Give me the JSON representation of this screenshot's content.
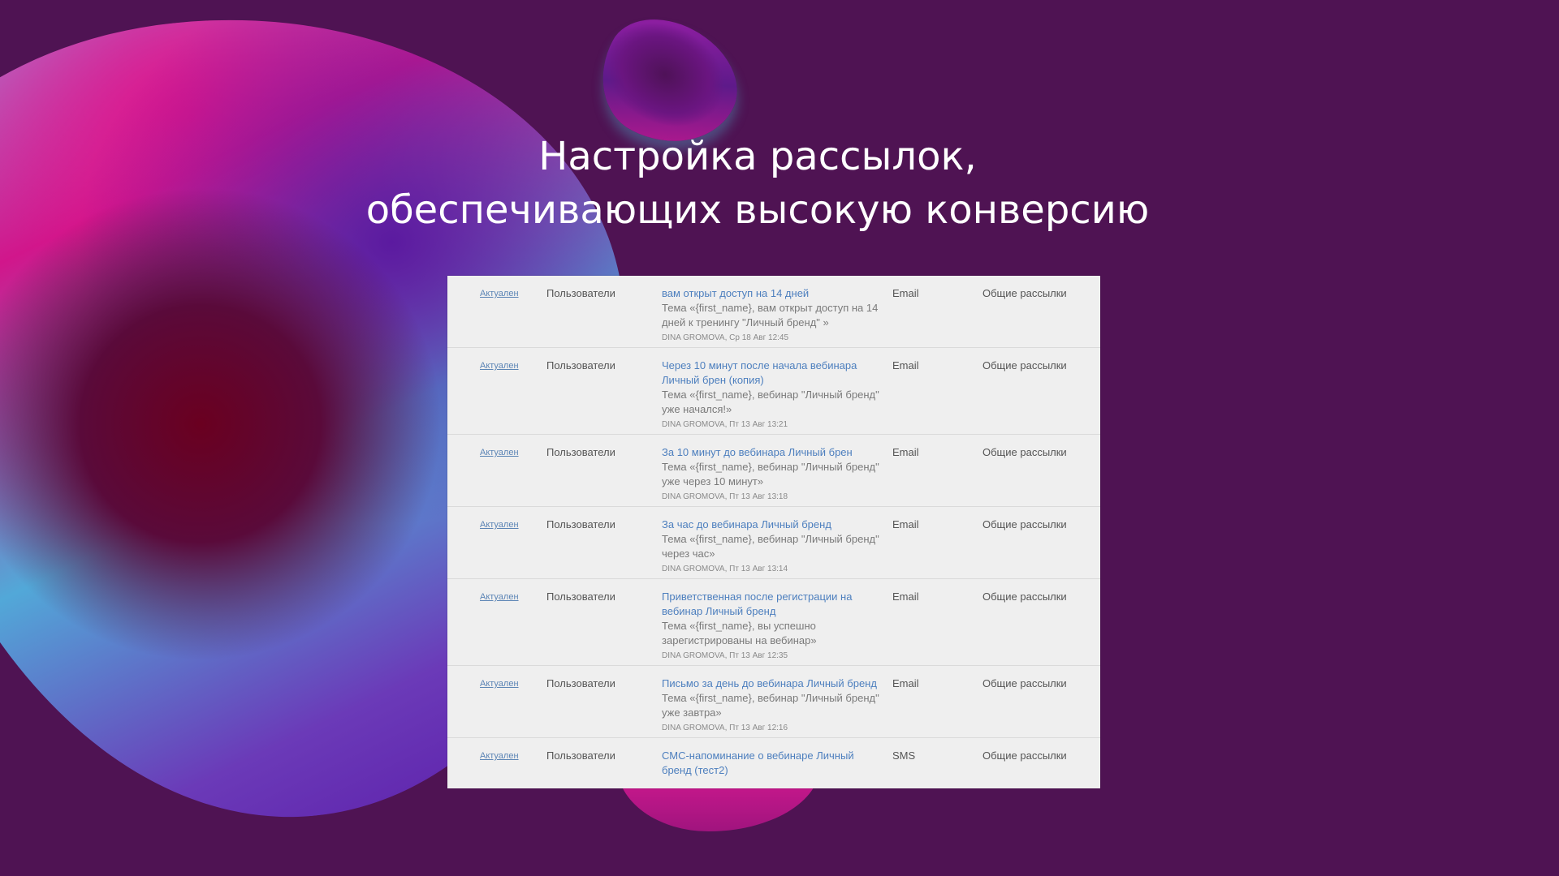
{
  "title_lines": [
    "Настройка рассылок,",
    "обеспечивающих высокую конверсию"
  ],
  "colors": {
    "background": "#4f1353",
    "table_bg": "#efefef",
    "link": "#4d7fbe",
    "text": "#555555"
  },
  "rows": [
    {
      "status": "Актуален",
      "audience": "Пользователи",
      "title": "вам открыт доступ на 14 дней",
      "subject": "Тема «{first_name}, вам открыт доступ на 14 дней к тренингу \"Личный бренд\" »",
      "meta": "DINA GROMOVA, Ср 18 Авг 12:45",
      "channel": "Email",
      "group": "Общие рассылки"
    },
    {
      "status": "Актуален",
      "audience": "Пользователи",
      "title": "Через 10 минут после начала вебинара Личный брен (копия)",
      "subject": "Тема «{first_name}, вебинар \"Личный бренд\" уже начался!»",
      "meta": "DINA GROMOVA, Пт 13 Авг 13:21",
      "channel": "Email",
      "group": "Общие рассылки"
    },
    {
      "status": "Актуален",
      "audience": "Пользователи",
      "title": "За 10 минут до вебинара Личный брен",
      "subject": "Тема «{first_name}, вебинар \"Личный бренд\" уже через 10 минут»",
      "meta": "DINA GROMOVA, Пт 13 Авг 13:18",
      "channel": "Email",
      "group": "Общие рассылки"
    },
    {
      "status": "Актуален",
      "audience": "Пользователи",
      "title": "За час до вебинара Личный бренд",
      "subject": "Тема «{first_name}, вебинар \"Личный бренд\" через час»",
      "meta": "DINA GROMOVA, Пт 13 Авг 13:14",
      "channel": "Email",
      "group": "Общие рассылки"
    },
    {
      "status": "Актуален",
      "audience": "Пользователи",
      "title": "Приветственная после регистрации на вебинар Личный бренд",
      "subject": "Тема «{first_name}, вы успешно зарегистрированы на вебинар»",
      "meta": "DINA GROMOVA, Пт 13 Авг 12:35",
      "channel": "Email",
      "group": "Общие рассылки"
    },
    {
      "status": "Актуален",
      "audience": "Пользователи",
      "title": "Письмо за день до вебинара Личный бренд",
      "subject": "Тема «{first_name}, вебинар \"Личный бренд\" уже завтра»",
      "meta": "DINA GROMOVA, Пт 13 Авг 12:16",
      "channel": "Email",
      "group": "Общие рассылки"
    },
    {
      "status": "Актуален",
      "audience": "Пользователи",
      "title": "СМС-напоминание о вебинаре Личный бренд (тест2)",
      "subject": "",
      "meta": "",
      "channel": "SMS",
      "group": "Общие рассылки"
    }
  ]
}
